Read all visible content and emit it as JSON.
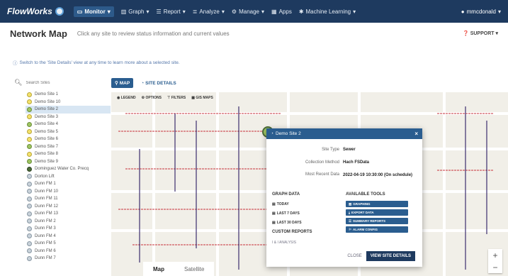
{
  "nav": {
    "brand": "FlowWorks",
    "items": [
      {
        "label": "Monitor",
        "icon": "monitor-icon"
      },
      {
        "label": "Graph",
        "icon": "graph-icon"
      },
      {
        "label": "Report",
        "icon": "report-icon"
      },
      {
        "label": "Analyze",
        "icon": "analyze-icon"
      },
      {
        "label": "Manage",
        "icon": "manage-icon"
      },
      {
        "label": "Apps",
        "icon": "apps-icon"
      },
      {
        "label": "Machine Learning",
        "icon": "machine-learning-icon"
      }
    ],
    "user": "mmcdonald"
  },
  "header": {
    "title": "Network Map",
    "subtitle": "Click any site to review status information and current values",
    "support": "SUPPORT"
  },
  "info": "Switch to the 'Site Details' view at any time to learn more about a selected site.",
  "search": {
    "placeholder": "Search Sites"
  },
  "sites": [
    {
      "label": "Demo Site 1",
      "status": "yellow"
    },
    {
      "label": "Demo Site 10",
      "status": "yellow"
    },
    {
      "label": "Demo Site 2",
      "status": "green",
      "selected": true
    },
    {
      "label": "Demo Site 3",
      "status": "yellow"
    },
    {
      "label": "Demo Site 4",
      "status": "green"
    },
    {
      "label": "Demo Site 5",
      "status": "yellow"
    },
    {
      "label": "Demo Site 6",
      "status": "yellow"
    },
    {
      "label": "Demo Site 7",
      "status": "green"
    },
    {
      "label": "Demo Site 8",
      "status": "yellow"
    },
    {
      "label": "Demo Site 9",
      "status": "green"
    },
    {
      "label": "Dominguez Water Co. Precq",
      "status": "dark"
    },
    {
      "label": "Dorton Lift",
      "status": "gray"
    },
    {
      "label": "Dunn FM 1",
      "status": "gray"
    },
    {
      "label": "Dunn FM 10",
      "status": "gray"
    },
    {
      "label": "Dunn FM 11",
      "status": "gray"
    },
    {
      "label": "Dunn FM 12",
      "status": "gray"
    },
    {
      "label": "Dunn FM 13",
      "status": "gray"
    },
    {
      "label": "Dunn FM 2",
      "status": "gray"
    },
    {
      "label": "Dunn FM 3",
      "status": "gray"
    },
    {
      "label": "Dunn FM 4",
      "status": "gray"
    },
    {
      "label": "Dunn FM 5",
      "status": "gray"
    },
    {
      "label": "Dunn FM 6",
      "status": "gray"
    },
    {
      "label": "Dunn FM 7",
      "status": "gray"
    }
  ],
  "tabs": {
    "map": "MAP",
    "site_details": "SITE DETAILS"
  },
  "map_toolbar": {
    "legend": "LEGEND",
    "options": "OPTIONS",
    "filters": "FILTERS",
    "gis": "GIS MAPS"
  },
  "map_type": {
    "map": "Map",
    "satellite": "Satellite"
  },
  "popup": {
    "title": "Demo Site 2",
    "site_type_label": "Site Type",
    "site_type": "Sewer",
    "method_label": "Collection Method",
    "method": "Hach FSData",
    "recent_label": "Most Recent Data",
    "recent": "2022-04-19 10:30:00 (On schedule)",
    "graph_data": "GRAPH DATA",
    "graph_items": [
      "TODAY",
      "LAST 7 DAYS",
      "LAST 30 DAYS"
    ],
    "custom_reports": "CUSTOM REPORTS",
    "custom_item": "I & I ANALYSIS",
    "tools_title": "AVAILABLE TOOLS",
    "tools": [
      "GRAPHING",
      "EXPORT DATA",
      "SUMMARY REPORTS",
      "ALARM CONFIG"
    ],
    "close": "CLOSE",
    "view": "VIEW SITE DETAILS"
  },
  "colors": {
    "navbar": "#1e3a5f",
    "accent": "#2a5d8f",
    "selected_row": "#d8e6f3"
  }
}
